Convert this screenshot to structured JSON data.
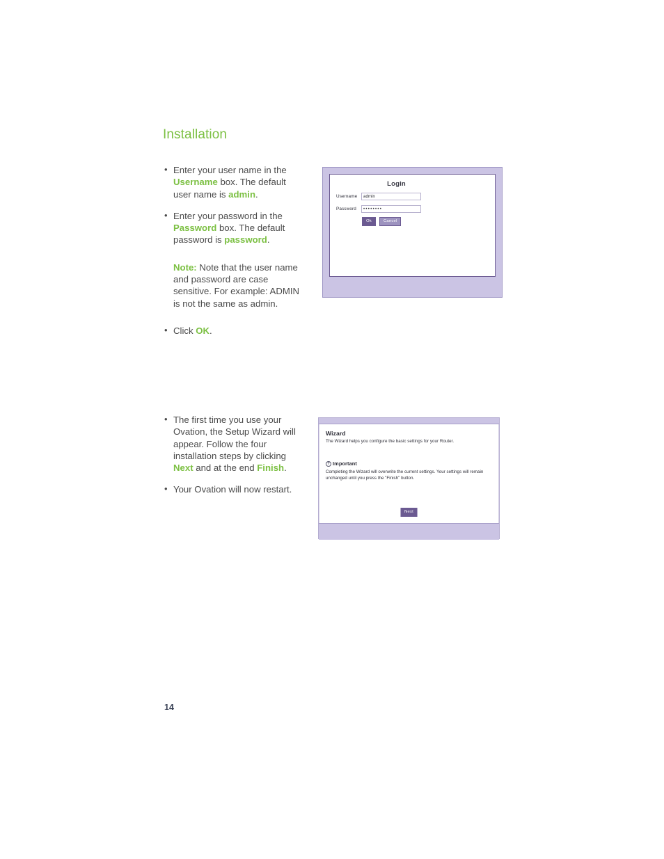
{
  "page": {
    "heading": "Installation",
    "number": "14",
    "accent_green": "#7cc043",
    "accent_purple": "#6b5a91",
    "frame_lavender": "#cbc4e4"
  },
  "instructions": {
    "group_one": [
      {
        "parts": [
          {
            "text": "Enter your user name in the ",
            "style": "plain"
          },
          {
            "text": "Username",
            "style": "green"
          },
          {
            "text": " box. The default user name is ",
            "style": "plain"
          },
          {
            "text": "admin",
            "style": "green"
          },
          {
            "text": ".",
            "style": "plain"
          }
        ]
      },
      {
        "parts": [
          {
            "text": "Enter your password in the ",
            "style": "plain"
          },
          {
            "text": "Password",
            "style": "green"
          },
          {
            "text": " box. The default password is ",
            "style": "plain"
          },
          {
            "text": "password",
            "style": "green"
          },
          {
            "text": ".",
            "style": "plain"
          }
        ]
      }
    ],
    "note": {
      "label": "Note:",
      "body": " Note that the user name and password are case sensitive. For example: ADMIN is not the same as admin."
    },
    "click_ok": {
      "parts": [
        {
          "text": "Click ",
          "style": "plain"
        },
        {
          "text": "OK",
          "style": "green"
        },
        {
          "text": ".",
          "style": "plain"
        }
      ]
    },
    "group_two": [
      {
        "parts": [
          {
            "text": "The first time you use your Ovation, the Setup Wizard will appear. Follow the four installation steps by clicking ",
            "style": "plain"
          },
          {
            "text": "Next",
            "style": "green"
          },
          {
            "text": " and at the end ",
            "style": "plain"
          },
          {
            "text": "Finish",
            "style": "green"
          },
          {
            "text": ".",
            "style": "plain"
          }
        ]
      },
      {
        "parts": [
          {
            "text": "Your Ovation will now restart.",
            "style": "plain"
          }
        ]
      }
    ]
  },
  "login_figure": {
    "title": "Login",
    "username_label": "Username",
    "username_value": "admin",
    "password_label": "Password",
    "password_value": "••••••••",
    "ok_label": "Ok",
    "cancel_label": "Cancel"
  },
  "wizard_figure": {
    "heading": "Wizard",
    "subtitle": "The Wizard helps you configure the basic settings for your Router.",
    "important_icon": "question-mark-icon",
    "important_label": "Important",
    "warning": "Completing the Wizard will overwrite the current settings. Your settings will remain unchanged until you press the \"Finish\" button.",
    "next_label": "Next"
  }
}
